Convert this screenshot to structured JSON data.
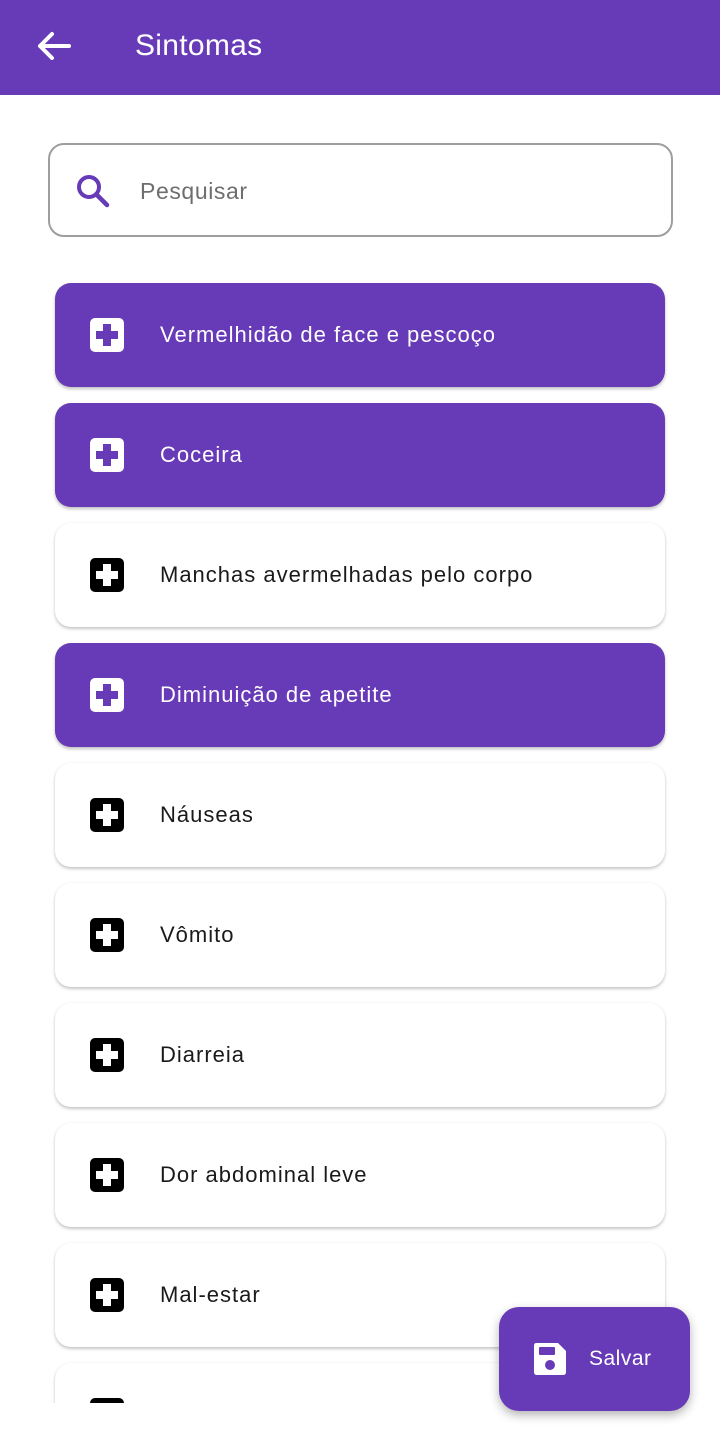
{
  "appbar": {
    "title": "Sintomas",
    "back_icon": "arrow-left-icon"
  },
  "search": {
    "placeholder": "Pesquisar",
    "value": "",
    "icon": "search-icon"
  },
  "symptoms": [
    {
      "label": "Vermelhidão de face e pescoço",
      "selected": true
    },
    {
      "label": "Coceira",
      "selected": true
    },
    {
      "label": "Manchas avermelhadas pelo corpo",
      "selected": false
    },
    {
      "label": "Diminuição de apetite",
      "selected": true
    },
    {
      "label": "Náuseas",
      "selected": false
    },
    {
      "label": "Vômito",
      "selected": false
    },
    {
      "label": "Diarreia",
      "selected": false
    },
    {
      "label": "Dor abdominal leve",
      "selected": false
    },
    {
      "label": "Mal-estar",
      "selected": false
    },
    {
      "label": "",
      "selected": false
    }
  ],
  "fab": {
    "label": "Salvar",
    "icon": "save-icon"
  },
  "colors": {
    "primary": "#673ab7",
    "selected_text": "#ffffff",
    "unselected_text": "#1a1a1a",
    "unselected_icon": "#000000"
  }
}
